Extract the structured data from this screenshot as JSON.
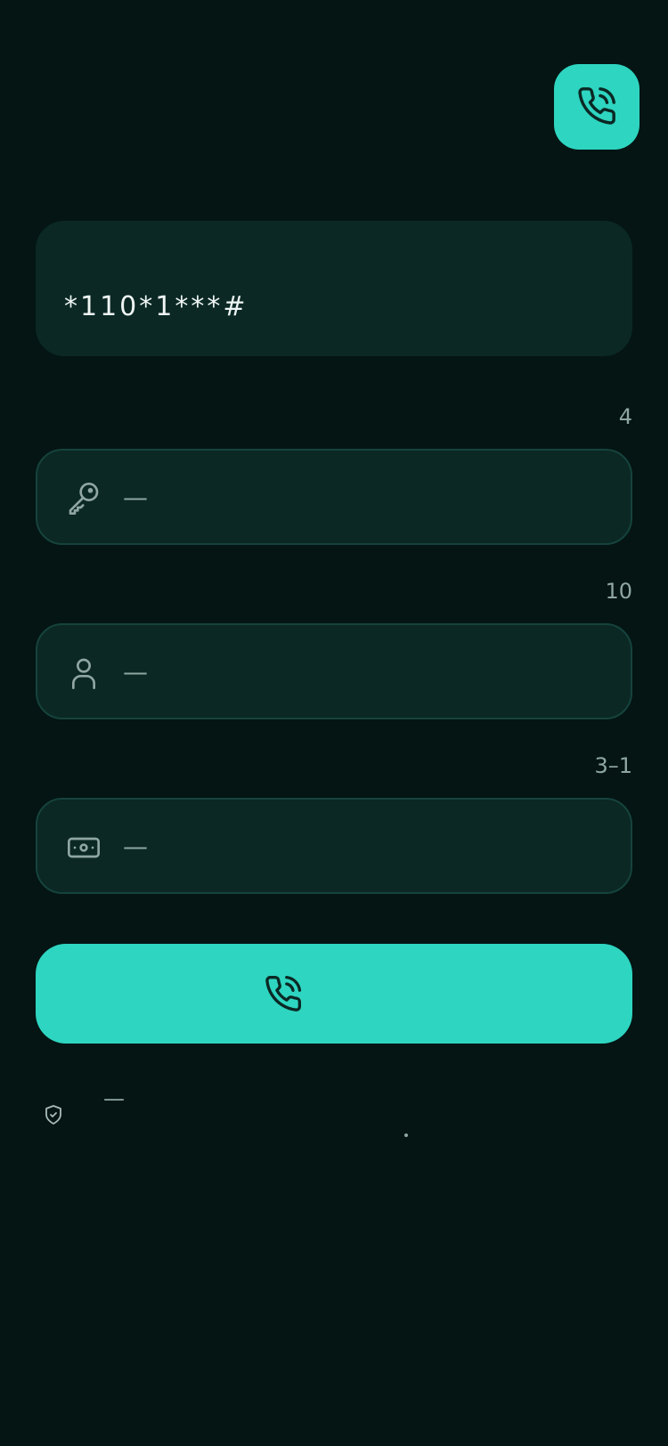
{
  "header": {
    "call_icon": "phone-call-icon"
  },
  "code_display": {
    "value": "*110*1***#"
  },
  "fields": [
    {
      "hint": "4",
      "icon": "key-icon",
      "placeholder": "—"
    },
    {
      "hint": "10",
      "icon": "user-icon",
      "placeholder": "—"
    },
    {
      "hint": "3–1",
      "icon": "banknote-icon",
      "placeholder": "—"
    }
  ],
  "call_button": {
    "icon": "phone-call-icon"
  },
  "footer": {
    "icon": "shield-check-icon",
    "text": "—"
  },
  "colors": {
    "background": "#041514",
    "accent": "#2ed5c0",
    "panel": "#0b2824",
    "panel_border": "#16433d",
    "text_primary": "#eef5f3",
    "text_muted": "#8fa6a2"
  }
}
